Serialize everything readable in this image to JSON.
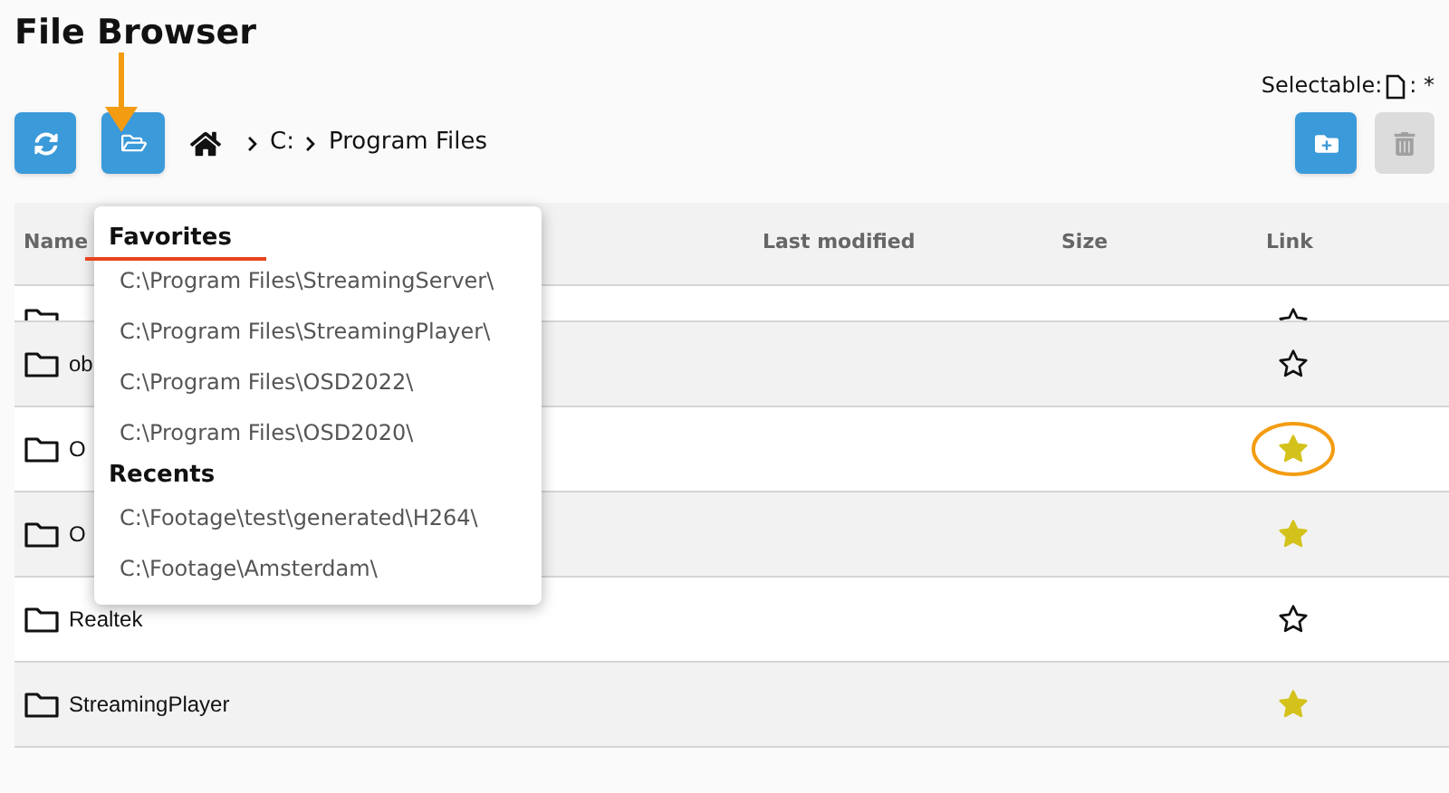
{
  "title": "File Browser",
  "selectable": {
    "label": "Selectable:",
    "value": ": *"
  },
  "breadcrumb": [
    "C:",
    "Program Files"
  ],
  "toolbar": {
    "delete_disabled": true
  },
  "table": {
    "columns": [
      "Name",
      "Last modified",
      "Size",
      "Link"
    ],
    "rows": [
      {
        "starred": false,
        "partial": true
      },
      {
        "name": "ob",
        "starred": false
      },
      {
        "name": "O",
        "starred": true,
        "highlighted": true
      },
      {
        "name": "O",
        "starred": true
      },
      {
        "name": "Realtek",
        "starred": false
      },
      {
        "name": "StreamingPlayer",
        "starred": true
      }
    ]
  },
  "dropdown": {
    "sections": [
      {
        "heading": "Favorites",
        "underlined": true,
        "items": [
          "C:\\Program Files\\StreamingServer\\",
          "C:\\Program Files\\StreamingPlayer\\",
          "C:\\Program Files\\OSD2022\\",
          "C:\\Program Files\\OSD2020\\"
        ]
      },
      {
        "heading": "Recents",
        "items": [
          "C:\\Footage\\test\\generated\\H264\\",
          "C:\\Footage\\Amsterdam\\"
        ]
      }
    ]
  }
}
